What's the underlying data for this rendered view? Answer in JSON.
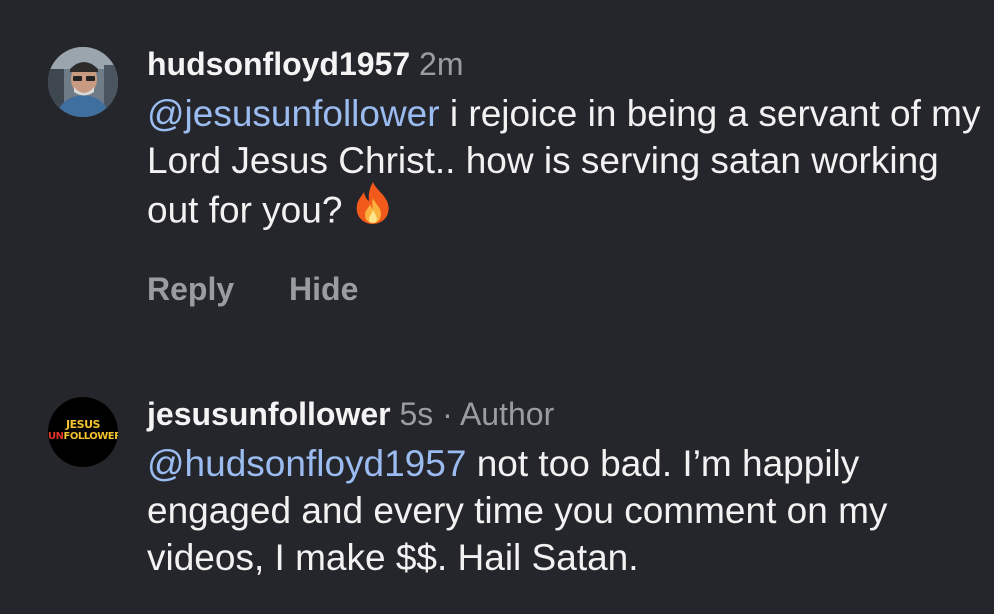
{
  "comments": [
    {
      "username": "hudsonfloyd1957",
      "time": "2m",
      "mention": "@jesusunfollower",
      "text": " i rejoice in being a servant of my Lord Jesus Christ.. how is serving satan working out for you?",
      "emoji_icon": "fire-icon",
      "actions": [
        "Reply",
        "Hide"
      ]
    },
    {
      "username": "jesusunfollower",
      "time": "5s",
      "separator": " · ",
      "badge": "Author",
      "mention": "@hudsonfloyd1957",
      "text": " not too bad. I’m happily engaged and every time you comment on my videos, I make $$. Hail Satan.",
      "avatar_text_line1": "JESUS",
      "avatar_text_line2_accent": "UN",
      "avatar_text_line2_rest": "FOLLOWER"
    }
  ],
  "colors": {
    "background": "#25262b",
    "mention": "#9bbcf1",
    "secondary_text": "#9a9ca2",
    "primary_text": "#f2f2f2",
    "logo_yellow": "#f2c230",
    "logo_red": "#e0362a"
  }
}
